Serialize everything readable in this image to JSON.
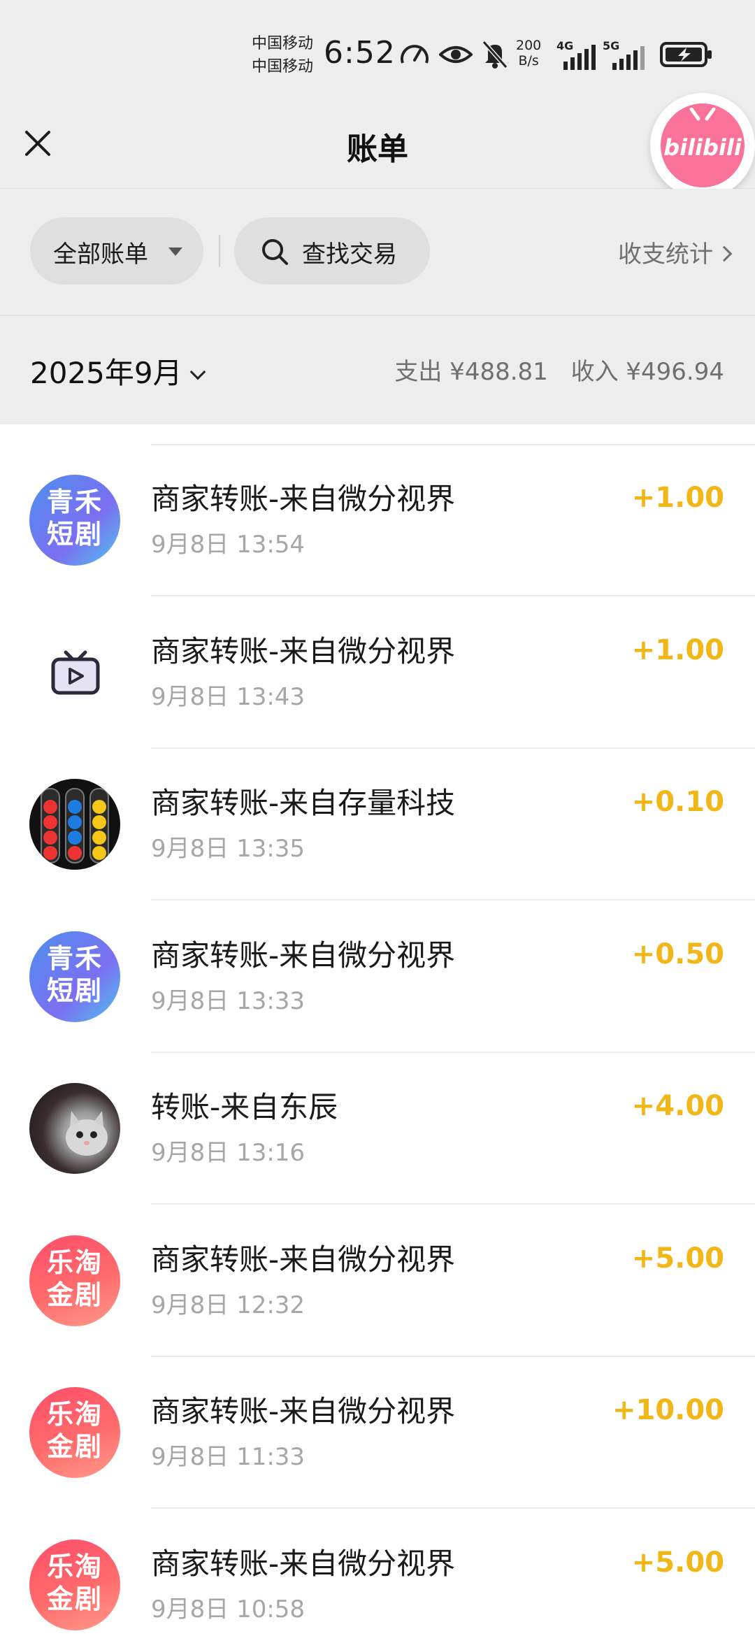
{
  "status_bar": {
    "carrier1": "中国移动",
    "carrier2": "中国移动",
    "time": "6:52",
    "net_speed_value": "200",
    "net_speed_unit": "B/s",
    "sig1": "4G",
    "sig2": "5G"
  },
  "header": {
    "title": "账单",
    "floating_app_label": "bilibili"
  },
  "filters": {
    "all_bills": "全部账单",
    "search": "查找交易",
    "stats": "收支统计"
  },
  "month_bar": {
    "month": "2025年9月",
    "expense": "支出 ¥488.81",
    "income": "收入 ¥496.94"
  },
  "transactions": [
    {
      "avatar": "qinghe",
      "avatar_text": [
        "青禾",
        "短剧"
      ],
      "title": "商家转账-来自微分视界",
      "time": "9月8日 13:54",
      "amount": "+1.00"
    },
    {
      "avatar": "tv",
      "title": "商家转账-来自微分视界",
      "time": "9月8日 13:43",
      "amount": "+1.00"
    },
    {
      "avatar": "balls",
      "title": "商家转账-来自存量科技",
      "time": "9月8日 13:35",
      "amount": "+0.10"
    },
    {
      "avatar": "qinghe",
      "avatar_text": [
        "青禾",
        "短剧"
      ],
      "title": "商家转账-来自微分视界",
      "time": "9月8日 13:33",
      "amount": "+0.50"
    },
    {
      "avatar": "cat",
      "title": "转账-来自东辰",
      "time": "9月8日 13:16",
      "amount": "+4.00"
    },
    {
      "avatar": "letao",
      "avatar_text": [
        "乐淘",
        "金剧"
      ],
      "title": "商家转账-来自微分视界",
      "time": "9月8日 12:32",
      "amount": "+5.00"
    },
    {
      "avatar": "letao",
      "avatar_text": [
        "乐淘",
        "金剧"
      ],
      "title": "商家转账-来自微分视界",
      "time": "9月8日 11:33",
      "amount": "+10.00"
    },
    {
      "avatar": "letao",
      "avatar_text": [
        "乐淘",
        "金剧"
      ],
      "title": "商家转账-来自微分视界",
      "time": "9月8日 10:58",
      "amount": "+5.00"
    }
  ],
  "colors": {
    "amount": "#f1b718",
    "background": "#ededed",
    "bilibili_pink": "#fb7299"
  }
}
